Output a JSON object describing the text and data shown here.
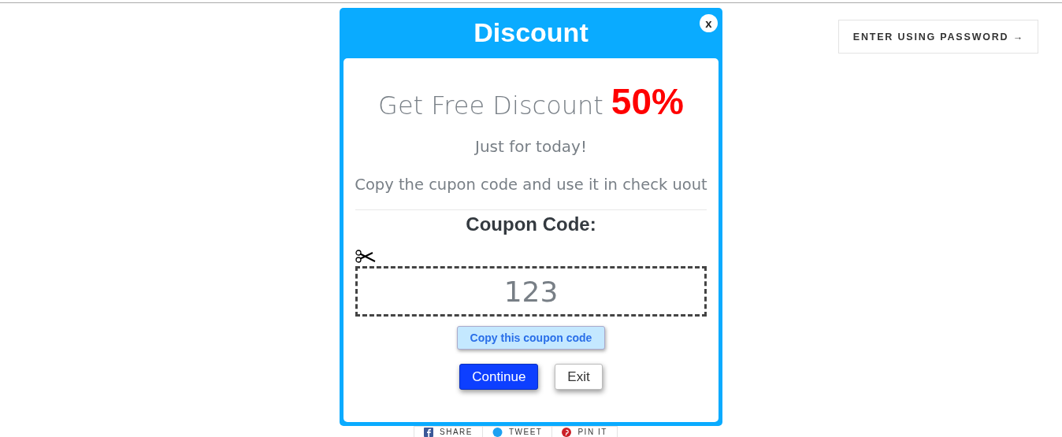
{
  "header": {
    "password_button": "ENTER USING PASSWORD →"
  },
  "share_bar": [
    {
      "label": "SHARE",
      "kind": "facebook"
    },
    {
      "label": "TWEET",
      "kind": "twitter"
    },
    {
      "label": "PIN IT",
      "kind": "pinterest"
    }
  ],
  "modal": {
    "title": "Discount",
    "close": "x",
    "headline": "Get Free Discount",
    "discount": "50%",
    "subtitle": "Just for today!",
    "instruction": "Copy the cupon code and use it in check uout",
    "code_label": "Coupon Code:",
    "code": "123",
    "copy_button": "Copy this coupon code",
    "buttons": [
      {
        "label": "Continue",
        "kind": "primary"
      },
      {
        "label": "Exit",
        "kind": "secondary"
      }
    ]
  }
}
